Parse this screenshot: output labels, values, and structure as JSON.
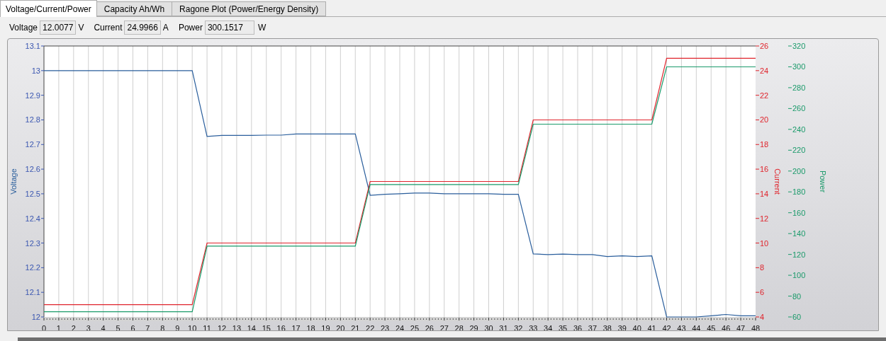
{
  "tabs": [
    {
      "label": "Voltage/Current/Power",
      "selected": true
    },
    {
      "label": "Capacity Ah/Wh",
      "selected": false
    },
    {
      "label": "Ragone Plot (Power/Energy Density)",
      "selected": false
    }
  ],
  "readouts": [
    {
      "label": "Voltage",
      "value": "12.0077",
      "unit": "V"
    },
    {
      "label": "Current",
      "value": "24.9966",
      "unit": "A"
    },
    {
      "label": "Power",
      "value": "300.1517",
      "unit": "W"
    }
  ],
  "chart_data": {
    "type": "line",
    "grid": true,
    "x": [
      0,
      1,
      2,
      3,
      4,
      5,
      6,
      7,
      8,
      9,
      10,
      11,
      12,
      13,
      14,
      15,
      16,
      17,
      18,
      19,
      20,
      21,
      22,
      23,
      24,
      25,
      26,
      27,
      28,
      29,
      30,
      31,
      32,
      33,
      34,
      35,
      36,
      37,
      38,
      39,
      40,
      41,
      42,
      43,
      44,
      45,
      46,
      47,
      48
    ],
    "xlim": [
      0,
      48
    ],
    "ylim": [
      12,
      13.1
    ],
    "xticks": [
      0,
      1,
      2,
      3,
      4,
      5,
      6,
      7,
      8,
      9,
      10,
      11,
      12,
      13,
      14,
      15,
      16,
      17,
      18,
      19,
      20,
      21,
      22,
      23,
      24,
      25,
      26,
      27,
      28,
      29,
      30,
      31,
      32,
      33,
      34,
      35,
      36,
      37,
      38,
      39,
      40,
      41,
      42,
      43,
      44,
      45,
      46,
      47,
      48
    ],
    "yticks": [
      {
        "value": 12,
        "label": "12"
      },
      {
        "value": 12.1,
        "label": "12.1"
      },
      {
        "value": 12.2,
        "label": "12.2"
      },
      {
        "value": 12.3,
        "label": "12.3"
      },
      {
        "value": 12.4,
        "label": "12.4"
      },
      {
        "value": 12.5,
        "label": "12.5"
      },
      {
        "value": 12.6,
        "label": "12.6"
      },
      {
        "value": 12.7,
        "label": "12.7"
      },
      {
        "value": 12.8,
        "label": "12.8"
      },
      {
        "value": 12.9,
        "label": "12.9"
      },
      {
        "value": 13,
        "label": "13"
      },
      {
        "value": 13.1,
        "label": "13.1"
      }
    ],
    "y2lim": [
      4,
      26
    ],
    "y2ticks": [
      4,
      6,
      8,
      10,
      12,
      14,
      16,
      18,
      20,
      22,
      24,
      26
    ],
    "y3lim": [
      60,
      320
    ],
    "y3ticks": [
      60,
      80,
      100,
      120,
      140,
      160,
      180,
      200,
      220,
      240,
      260,
      280,
      300,
      320
    ],
    "series": [
      {
        "name": "Voltage",
        "color": "#2a5e9c",
        "values": [
          13,
          13,
          13,
          13,
          13,
          13,
          13,
          13,
          13,
          13,
          13,
          12.733,
          12.737,
          12.737,
          12.737,
          12.738,
          12.738,
          12.743,
          12.743,
          12.743,
          12.743,
          12.743,
          12.494,
          12.498,
          12.5,
          12.503,
          12.503,
          12.5,
          12.5,
          12.5,
          12.5,
          12.498,
          12.498,
          12.256,
          12.253,
          12.255,
          12.253,
          12.253,
          12.245,
          12.248,
          12.245,
          12.248,
          12,
          12,
          12,
          12.005,
          12.01,
          12.005,
          12.005
        ]
      },
      {
        "name": "Current",
        "color": "#e0242c",
        "axis": "y2",
        "values": [
          5,
          5,
          5,
          5,
          5,
          5,
          5,
          5,
          5,
          5,
          5,
          10,
          10,
          10,
          10,
          10,
          10,
          10,
          10,
          10,
          10,
          10,
          15,
          15,
          15,
          15,
          15,
          15,
          15,
          15,
          15,
          15,
          15,
          20,
          20,
          20,
          20,
          20,
          20,
          20,
          20,
          20,
          25,
          25,
          25,
          25,
          25,
          25,
          25
        ]
      },
      {
        "name": "Power",
        "color": "#1a9a6a",
        "axis": "y3",
        "values": [
          65,
          65,
          65,
          65,
          65,
          65,
          65,
          65,
          65,
          65,
          65,
          128,
          128,
          128,
          128,
          128,
          128,
          128,
          128,
          128,
          128,
          128,
          187,
          187,
          187,
          187,
          187,
          187,
          187,
          187,
          187,
          187,
          187,
          245,
          245,
          245,
          245,
          245,
          245,
          245,
          245,
          245,
          300,
          300,
          300,
          300,
          300,
          300,
          300
        ]
      }
    ]
  }
}
